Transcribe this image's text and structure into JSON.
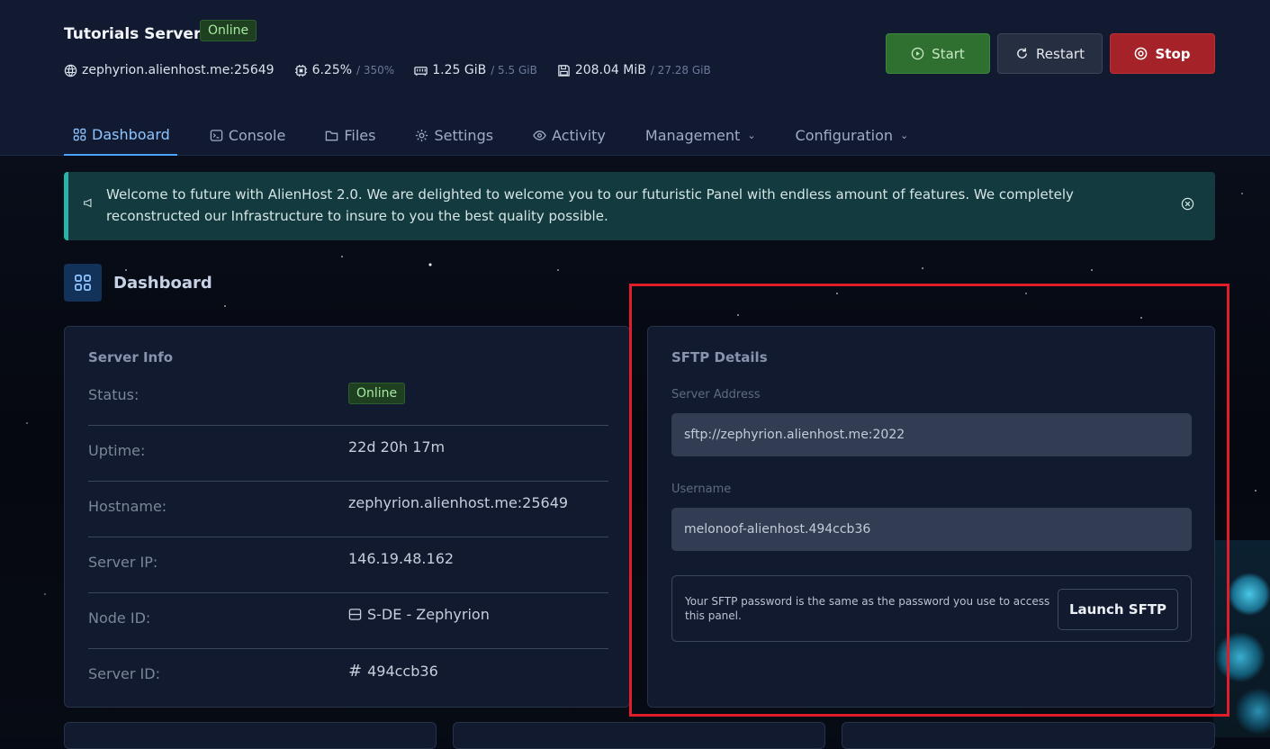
{
  "server": {
    "title": "Tutorials Server",
    "status": "Online",
    "address": "zephyrion.alienhost.me:25649",
    "cpu": "6.25%",
    "cpu_limit": "/ 350%",
    "memory": "1.25 GiB",
    "memory_limit": "/ 5.5 GiB",
    "disk": "208.04 MiB",
    "disk_limit": "/ 27.28 GiB"
  },
  "controls": {
    "start": "Start",
    "restart": "Restart",
    "stop": "Stop"
  },
  "tabs": [
    {
      "label": "Dashboard"
    },
    {
      "label": "Console"
    },
    {
      "label": "Files"
    },
    {
      "label": "Settings"
    },
    {
      "label": "Activity"
    },
    {
      "label": "Management"
    },
    {
      "label": "Configuration"
    }
  ],
  "alert": {
    "text": "Welcome to future with AlienHost 2.0. We are delighted to welcome you to our futuristic Panel with endless amount of features. We completely reconstructed our Infrastructure to insure to you the best quality possible."
  },
  "page_title": "Dashboard",
  "server_info": {
    "title": "Server Info",
    "rows": [
      {
        "label": "Status:",
        "value": "Online"
      },
      {
        "label": "Uptime:",
        "value": "22d 20h 17m"
      },
      {
        "label": "Hostname:",
        "value": "zephyrion.alienhost.me:25649"
      },
      {
        "label": "Server IP:",
        "value": "146.19.48.162"
      },
      {
        "label": "Node ID:",
        "value": "S-DE - Zephyrion"
      },
      {
        "label": "Server ID:",
        "value": "494ccb36"
      }
    ]
  },
  "sftp": {
    "title": "SFTP Details",
    "address_label": "Server Address",
    "address": "sftp://zephyrion.alienhost.me:2022",
    "username_label": "Username",
    "username": "melonoof-alienhost.494ccb36",
    "note": "Your SFTP password is the same as the password you use to access this panel.",
    "launch": "Launch SFTP"
  },
  "colors": {
    "accent": "#4aa3ff",
    "online": "#a7e9a2",
    "stop": "#a52328",
    "start": "#2f6f2f",
    "highlight": "#e11d2a"
  }
}
